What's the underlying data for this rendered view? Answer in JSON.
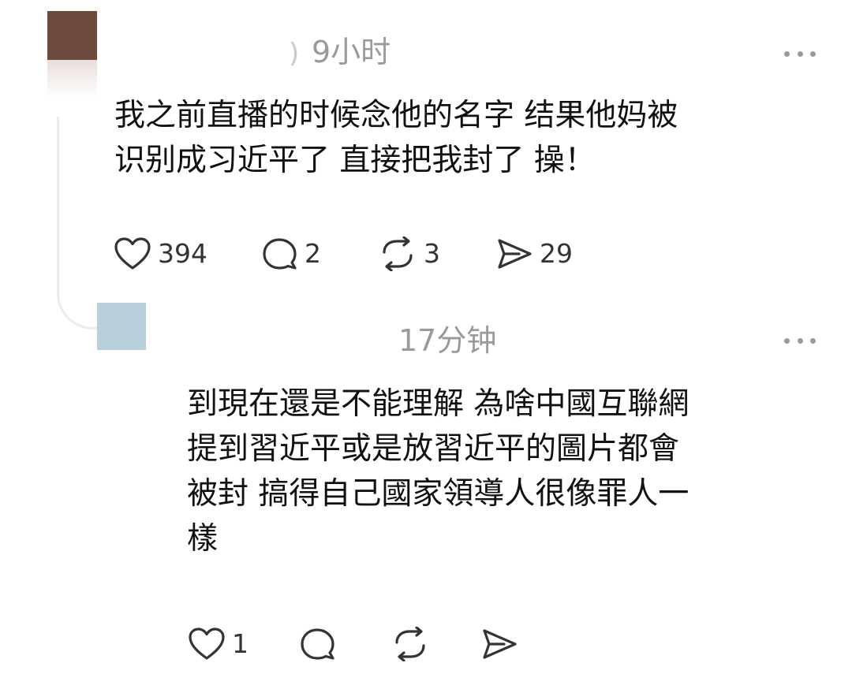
{
  "comments": [
    {
      "name_fragment": ")",
      "timestamp": "9小时",
      "text_line1": "我之前直播的时候念他的名字 结果他妈被",
      "text_line2": "识别成习近平了 直接把我封了 操！",
      "likes": "394",
      "replies": "2",
      "reposts": "3",
      "shares": "29",
      "avatar_color": "#6b4a3c",
      "icons": [
        "heart-icon",
        "speech-bubble-icon",
        "repost-icon",
        "send-icon",
        "more-icon"
      ]
    },
    {
      "timestamp": "17分钟",
      "text_line1": "到現在還是不能理解 為啥中國互聯網",
      "text_line2": "提到習近平或是放習近平的圖片都會",
      "text_line3": "被封 搞得自己國家領導人很像罪人一",
      "text_line4": "樣",
      "likes": "1",
      "avatar_color": "#b8ced9",
      "icons": [
        "heart-icon",
        "speech-bubble-icon",
        "repost-icon",
        "send-icon",
        "more-icon"
      ]
    }
  ],
  "colors": {
    "text": "#111111",
    "muted": "#9a9a9a",
    "icon": "#333333"
  }
}
